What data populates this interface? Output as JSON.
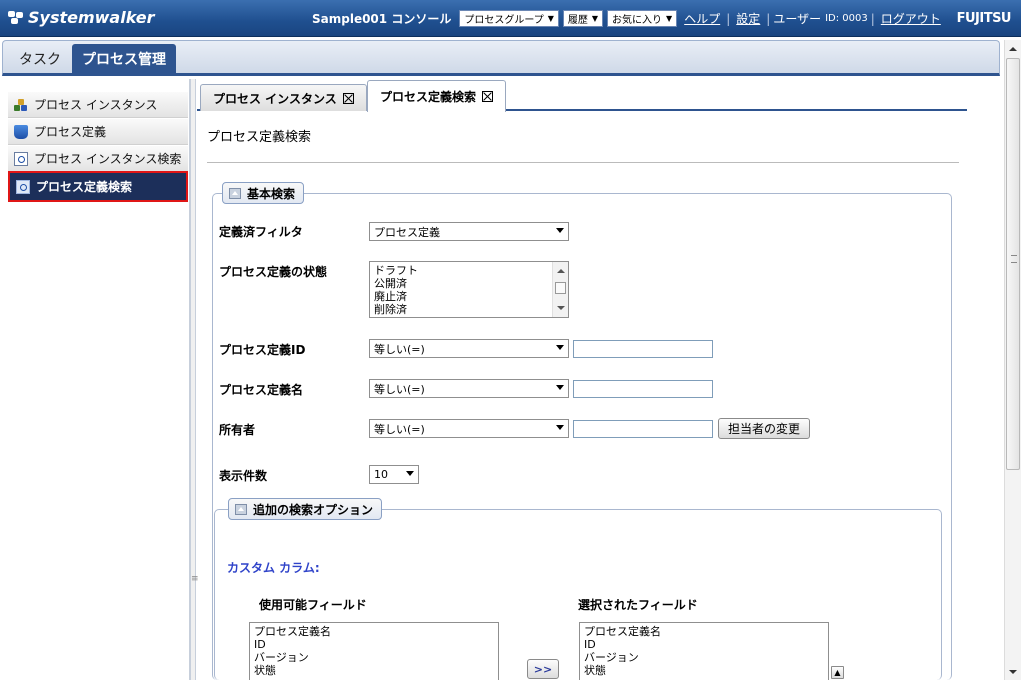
{
  "header": {
    "logo_text": "Systemwalker",
    "console_name": "Sample001 コンソール",
    "dropdowns": [
      "プロセスグループ",
      "履歴",
      "お気に入り"
    ],
    "help_link": "ヘルプ",
    "settings_link": "設定",
    "user_label": "ユーザー",
    "user_id": "ID: 0003",
    "logout_link": "ログアウト",
    "vendor": "FUJITSU"
  },
  "main_tabs": [
    {
      "label": "タスク",
      "active": false
    },
    {
      "label": "プロセス管理",
      "active": true
    }
  ],
  "sidebar": {
    "items": [
      {
        "label": "プロセス インスタンス",
        "icon": "process-instances-icon"
      },
      {
        "label": "プロセス定義",
        "icon": "process-definition-icon"
      },
      {
        "label": "プロセス インスタンス検索",
        "icon": "search-page-icon"
      },
      {
        "label": "プロセス定義検索",
        "icon": "search-page-icon",
        "active": true
      }
    ]
  },
  "content_tabs": [
    {
      "label": "プロセス インスタンス"
    },
    {
      "label": "プロセス定義検索",
      "active": true
    }
  ],
  "page_title": "プロセス定義検索",
  "basic_search": {
    "legend": "基本検索",
    "filter": {
      "label": "定義済フィルタ",
      "value": "プロセス定義"
    },
    "state": {
      "label": "プロセス定義の状態",
      "options": [
        "ドラフト",
        "公開済",
        "廃止済",
        "削除済"
      ]
    },
    "def_id": {
      "label": "プロセス定義ID",
      "operator": "等しい(=)",
      "value": ""
    },
    "def_name": {
      "label": "プロセス定義名",
      "operator": "等しい(=)",
      "value": ""
    },
    "owner": {
      "label": "所有者",
      "operator": "等しい(=)",
      "value": "",
      "button": "担当者の変更"
    },
    "count": {
      "label": "表示件数",
      "value": "10"
    }
  },
  "extra_options": {
    "legend": "追加の検索オプション",
    "custom_columns": "カスタム カラム:",
    "available_title": "使用可能フィールド",
    "selected_title": "選択されたフィールド",
    "available_fields": [
      "プロセス定義名",
      "ID",
      "バージョン",
      "状態"
    ],
    "selected_fields": [
      "プロセス定義名",
      "ID",
      "バージョン",
      "状態"
    ],
    "move_button": ">>"
  },
  "colors": {
    "header_blue": "#1f4f8f",
    "active_tab": "#2e548f",
    "sidebar_active": "#1c2f5a",
    "highlight_border": "#e01616",
    "custom_label": "#2f43c9"
  }
}
